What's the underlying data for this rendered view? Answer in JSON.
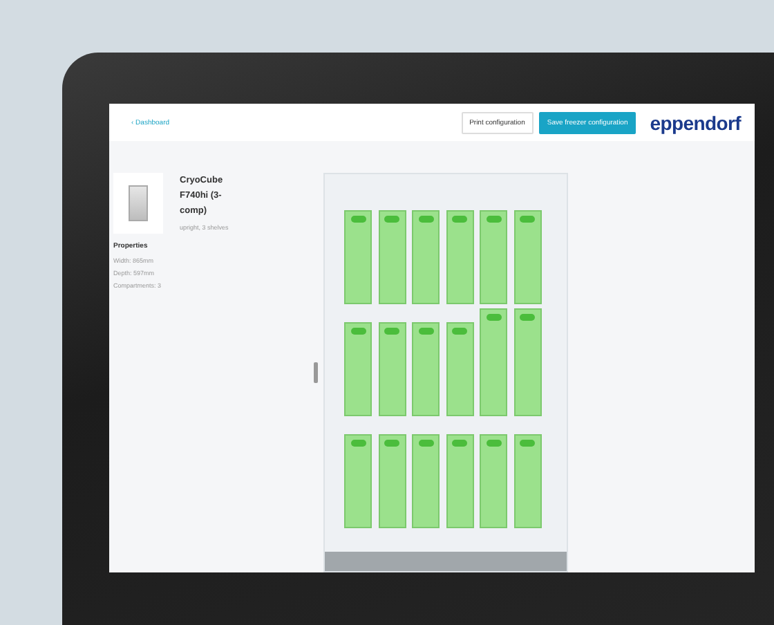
{
  "breadcrumb": "‹ Dashboard",
  "buttons": [
    {
      "label": "Print configuration",
      "kind": "secondary"
    },
    {
      "label": "Save freezer configuration",
      "kind": "primary"
    }
  ],
  "brand": "eppendorf",
  "product": {
    "name": "CryoCube F740hi (3-comp)",
    "subtitle": "upright, 3 shelves"
  },
  "properties": {
    "title": "Properties",
    "items": [
      "Width: 865mm",
      "Depth: 597mm",
      "Compartments: 3"
    ]
  },
  "shelves": [
    {
      "racks": [
        {
          "raised": false
        },
        {
          "raised": false
        },
        {
          "raised": false
        },
        {
          "raised": false
        },
        {
          "raised": false
        },
        {
          "raised": false
        }
      ]
    },
    {
      "racks": [
        {
          "raised": false
        },
        {
          "raised": false
        },
        {
          "raised": false
        },
        {
          "raised": false
        },
        {
          "raised": true
        },
        {
          "raised": true
        }
      ]
    },
    {
      "racks": [
        {
          "raised": false
        },
        {
          "raised": false
        },
        {
          "raised": false
        },
        {
          "raised": false
        },
        {
          "raised": false
        },
        {
          "raised": false
        }
      ]
    }
  ]
}
